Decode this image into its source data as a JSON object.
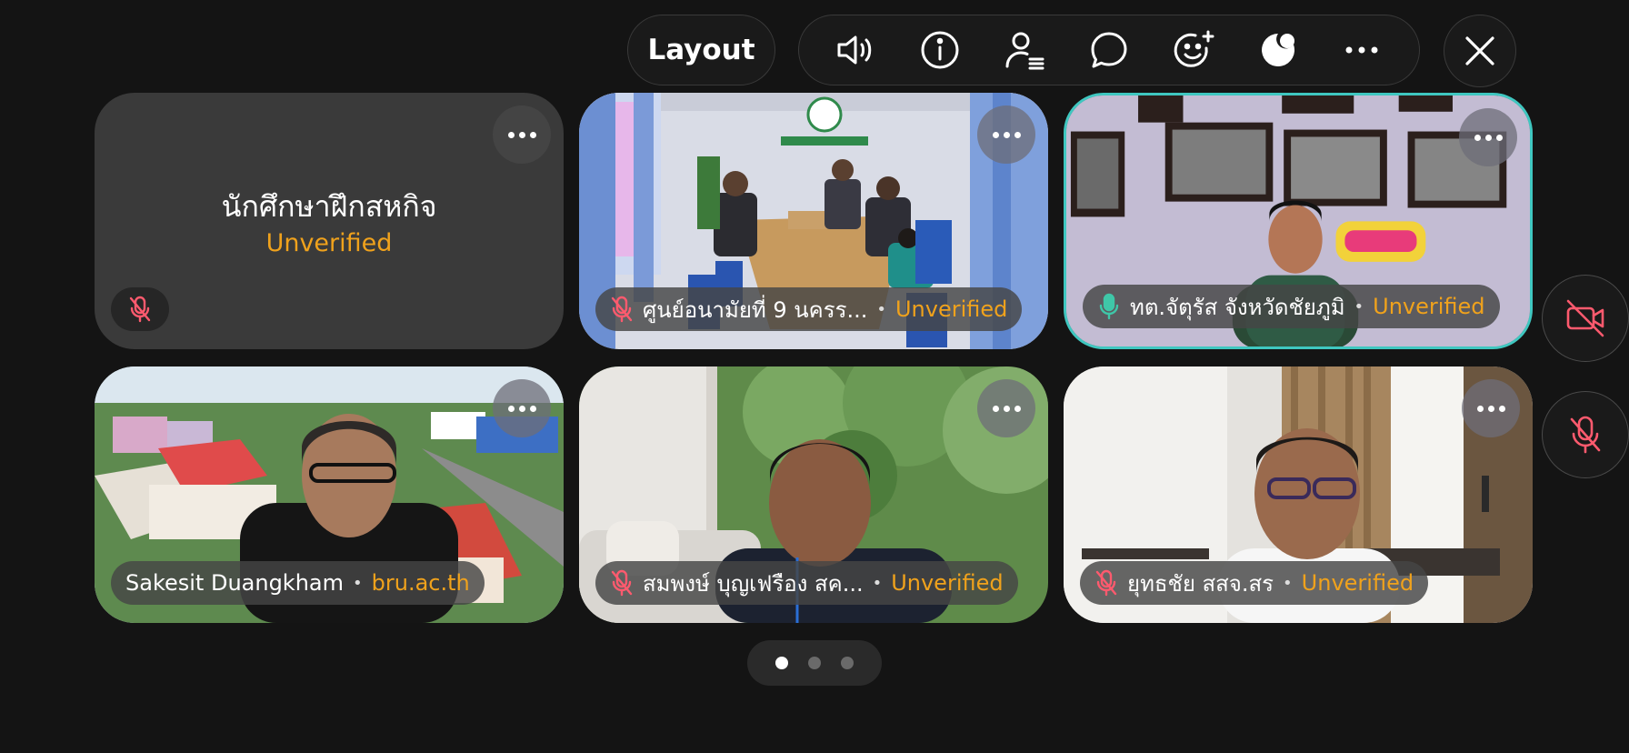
{
  "toolbar": {
    "layout_label": "Layout",
    "icons": [
      "speaker-icon",
      "info-icon",
      "participants-icon",
      "chat-icon",
      "reactions-icon",
      "effects-icon",
      "more-icon"
    ],
    "close_icon": "close-icon"
  },
  "tiles": [
    {
      "name": "นักศึกษาฝึกสหกิจ",
      "status": "Unverified",
      "muted": true,
      "video": false
    },
    {
      "name": "ศูนย์อนามัยที่ 9 นครร...",
      "status": "Unverified",
      "muted": true,
      "video": true
    },
    {
      "name": "ทต.จัตุรัส จังหวัดชัยภูมิ",
      "status": "Unverified",
      "muted": false,
      "video": true,
      "speaking": true
    },
    {
      "name": "Sakesit Duangkham",
      "status": "bru.ac.th",
      "muted": false,
      "video": true
    },
    {
      "name": "สมพงษ์ บุญเฟรือง สค...",
      "status": "Unverified",
      "muted": true,
      "video": true
    },
    {
      "name": "ยุทธชัย สสจ.สร",
      "status": "Unverified",
      "muted": true,
      "video": true
    }
  ],
  "separator": "•",
  "side_controls": [
    "camera-off-icon",
    "mic-off-icon"
  ],
  "pager": {
    "pages": 3,
    "current": 1
  },
  "colors": {
    "background": "#141414",
    "unverified": "#f0a21c",
    "speaking_border": "#3fc7c0",
    "muted_red": "#ff5a6e"
  }
}
